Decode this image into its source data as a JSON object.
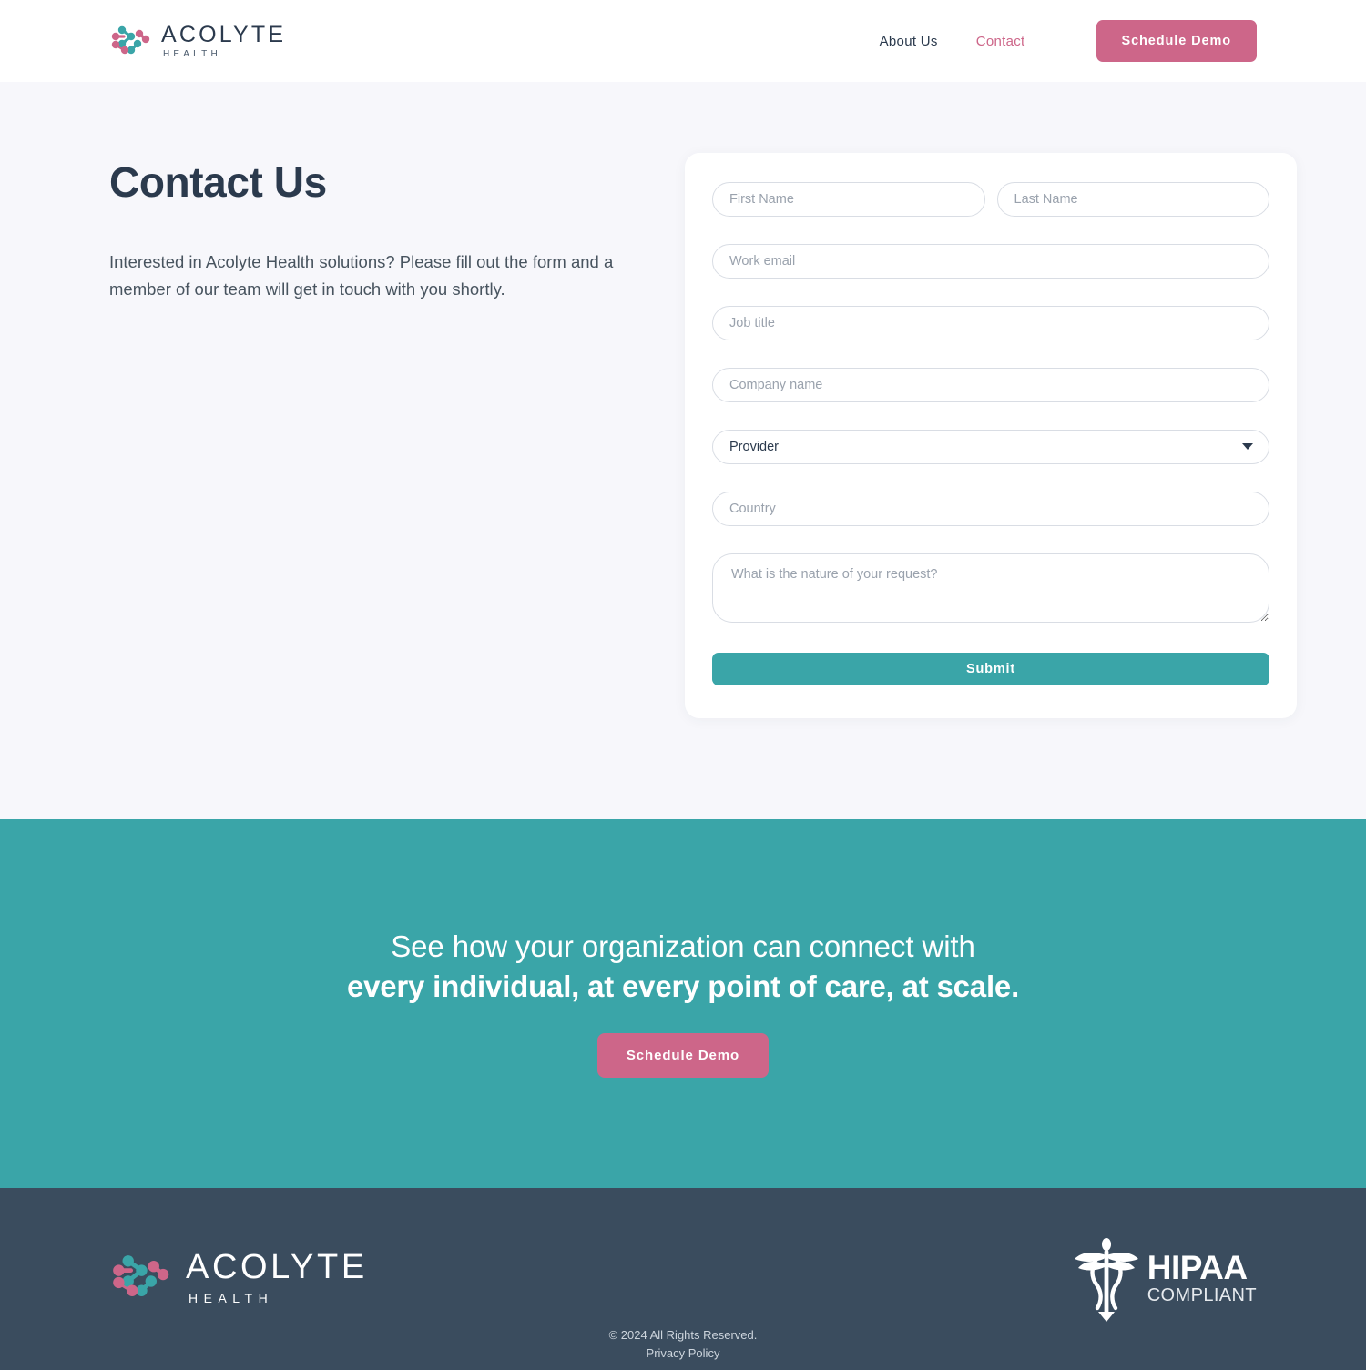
{
  "header": {
    "brand": {
      "name": "ACOLYTE",
      "sub": "HEALTH",
      "logo_icon": "molecule-network-icon"
    },
    "nav": [
      {
        "label": "About Us",
        "active": false
      },
      {
        "label": "Contact",
        "active": true
      }
    ],
    "cta_button": "Schedule Demo"
  },
  "main": {
    "title": "Contact Us",
    "description": "Interested in Acolyte Health solutions? Please fill out the form and a member of our team will get in touch with you shortly.",
    "form": {
      "first_name": {
        "placeholder": "First Name",
        "value": ""
      },
      "last_name": {
        "placeholder": "Last Name",
        "value": ""
      },
      "work_email": {
        "placeholder": "Work email",
        "value": ""
      },
      "job_title": {
        "placeholder": "Job title",
        "value": ""
      },
      "company_name": {
        "placeholder": "Company name",
        "value": ""
      },
      "organization_type": {
        "selected": "Provider",
        "options": [
          "Provider"
        ]
      },
      "country": {
        "placeholder": "Country",
        "value": ""
      },
      "request": {
        "placeholder": "What is the nature of your request?",
        "value": ""
      },
      "submit_label": "Submit"
    }
  },
  "cta": {
    "line1": "See how your organization can connect with",
    "line2": "every individual, at every point of care, at scale.",
    "button": "Schedule Demo"
  },
  "footer": {
    "brand": {
      "name": "ACOLYTE",
      "sub": "HEALTH",
      "logo_icon": "molecule-network-icon"
    },
    "hipaa": {
      "title": "HIPAA",
      "sub": "COMPLIANT",
      "icon": "caduceus-icon"
    },
    "copyright": "© 2024 All Rights Reserved.",
    "privacy_label": "Privacy Policy"
  },
  "colors": {
    "pink": "#cd6689",
    "teal": "#3aa5a8",
    "dark_slate": "#3a4c5e",
    "page_bg": "#f7f7fb",
    "text_dark": "#2b3a4d"
  }
}
